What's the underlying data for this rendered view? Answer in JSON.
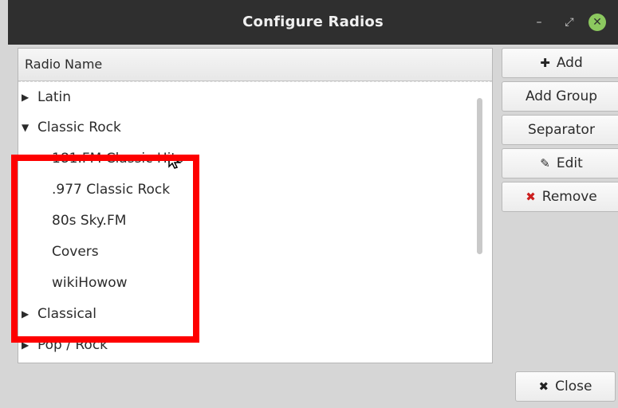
{
  "window": {
    "title": "Configure Radios"
  },
  "tree": {
    "column_header": "Radio Name",
    "items": [
      {
        "label": "Latin",
        "expander": "collapsed"
      },
      {
        "label": "Classic Rock",
        "expander": "expanded"
      },
      {
        "label": "181.FM Classic Hits",
        "expander": "none"
      },
      {
        "label": ".977 Classic Rock",
        "expander": "none"
      },
      {
        "label": "80s Sky.FM",
        "expander": "none"
      },
      {
        "label": "Covers",
        "expander": "none"
      },
      {
        "label": "wikiHowow",
        "expander": "none"
      },
      {
        "label": "Classical",
        "expander": "collapsed"
      },
      {
        "label": "Pop / Rock",
        "expander": "collapsed"
      }
    ]
  },
  "buttons": {
    "add": {
      "label": "Add",
      "icon": "plus-icon"
    },
    "add_group": {
      "label": "Add Group"
    },
    "separator": {
      "label": "Separator"
    },
    "edit": {
      "label": "Edit",
      "icon": "pencil-icon"
    },
    "remove": {
      "label": "Remove",
      "icon": "red-x-icon"
    },
    "close": {
      "label": "Close",
      "icon": "x-icon"
    }
  },
  "colors": {
    "titlebar": "#2f2f2f",
    "close_button": "#8cc85f",
    "highlight_box": "#fe0000",
    "remove_icon": "#cc1f1f"
  }
}
